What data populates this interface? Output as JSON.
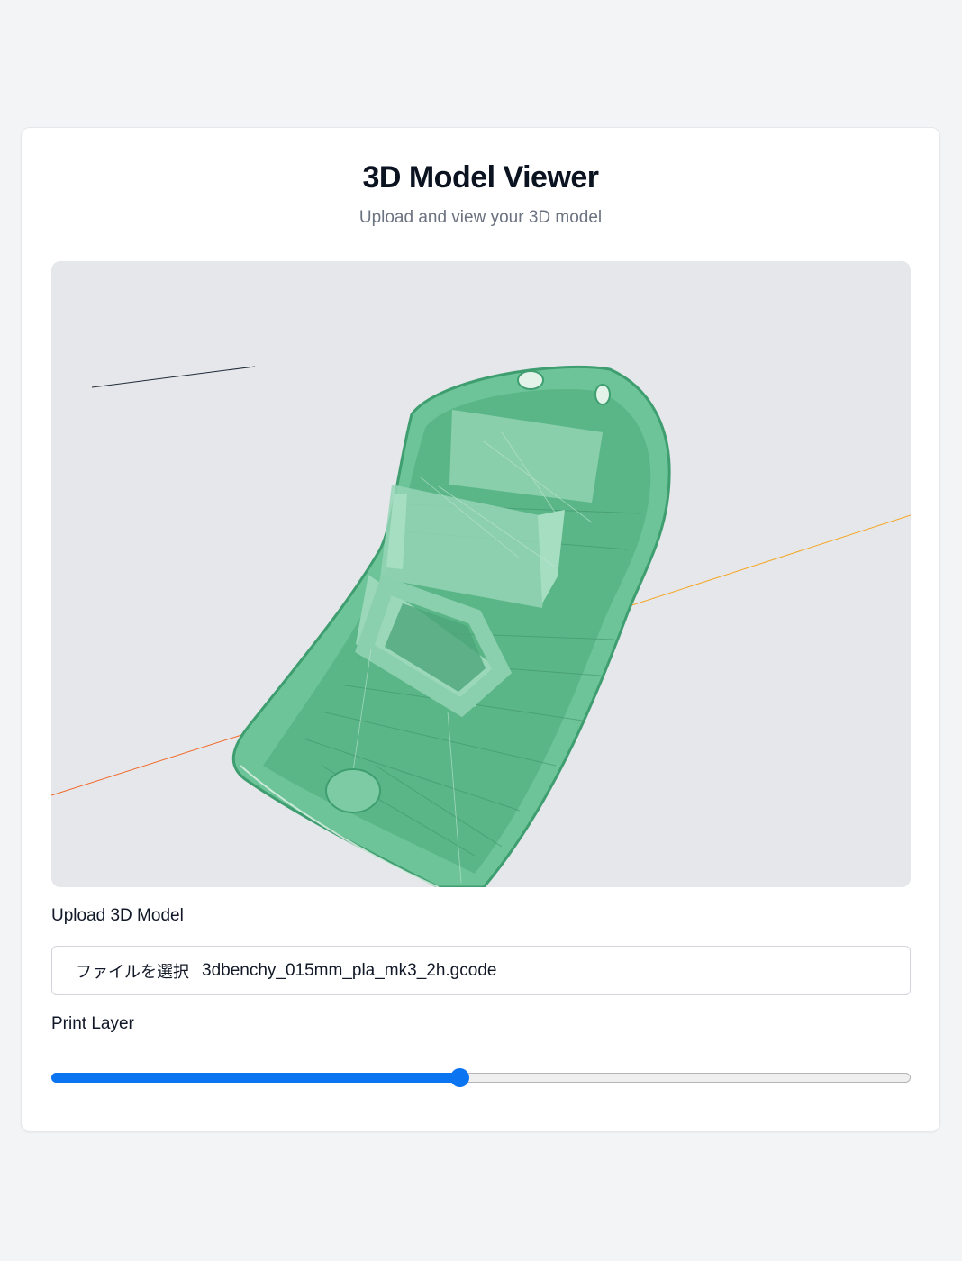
{
  "page": {
    "title": "3D Model Viewer",
    "subtitle": "Upload and view your 3D model"
  },
  "viewer": {
    "model_color": "#5fb88c",
    "background_color": "#e5e7eb",
    "axis_x_color": "#f26522",
    "axis_z_color": "#1f2937",
    "axis_y_color": "#f5a623"
  },
  "upload": {
    "label": "Upload 3D Model",
    "button_label": "ファイルを選択",
    "file_name": "3dbenchy_015mm_pla_mk3_2h.gcode"
  },
  "layer": {
    "label": "Print Layer",
    "value_fraction": 0.475,
    "accent_color": "#0b74f1"
  }
}
